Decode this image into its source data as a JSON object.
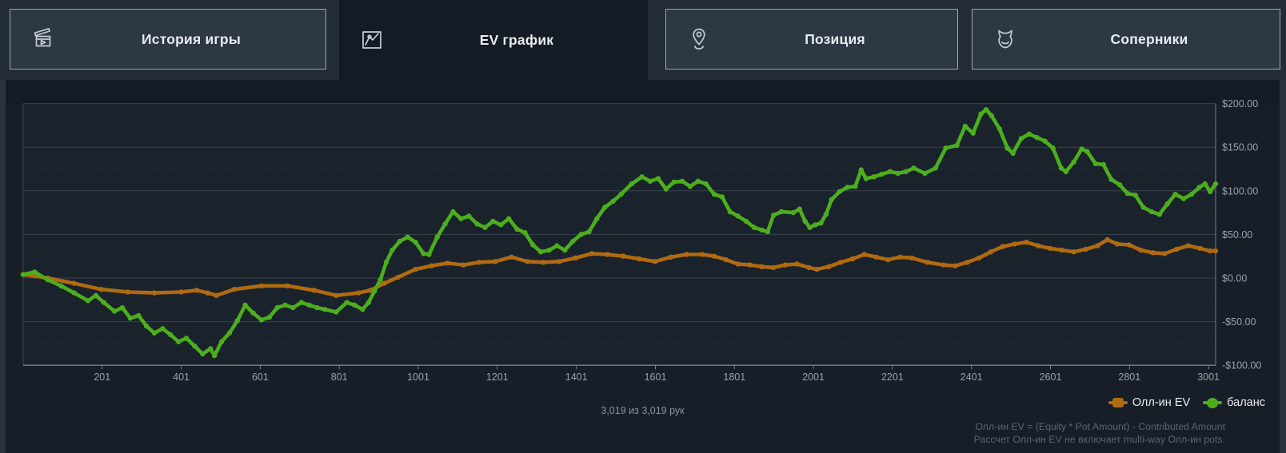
{
  "tabs": [
    {
      "label": "История игры",
      "icon": "clapperboard-icon",
      "active": false
    },
    {
      "label": "EV график",
      "icon": "line-chart-icon",
      "active": true
    },
    {
      "label": "Позиция",
      "icon": "location-pin-icon",
      "active": false
    },
    {
      "label": "Соперники",
      "icon": "opponent-mask-icon",
      "active": false
    }
  ],
  "hands_counter": "3,019 из 3,019 рук",
  "legend": [
    {
      "label": "Олл-ин EV",
      "color": "#b06a10",
      "marker": "square"
    },
    {
      "label": "баланс",
      "color": "#4cae1d",
      "marker": "circle"
    }
  ],
  "footnote": {
    "line1": "Олл-ин EV = (Equity * Pot Amount) - Contributed Amount",
    "line2": "Рассчет Олл-ин EV не включает multi-way Олл-ин pots."
  },
  "colors": {
    "allin_ev": "#b06a10",
    "balance": "#4cae1d",
    "grid_major": "#39434e",
    "grid_minor": "#2a3440",
    "axis": "#78828c",
    "tick_text": "#99a1a9",
    "panel_bg": "#171e28",
    "plot_bg": "#1a222c"
  },
  "chart_data": {
    "type": "line",
    "title": "",
    "xlabel": "",
    "ylabel": "",
    "xlim": [
      1,
      3019
    ],
    "ylim": [
      -100,
      200
    ],
    "x_ticks": [
      201,
      401,
      601,
      801,
      1001,
      1201,
      1401,
      1601,
      1801,
      2001,
      2201,
      2401,
      2601,
      2801,
      3001
    ],
    "y_ticks": [
      {
        "value": 200,
        "label": "$200.00"
      },
      {
        "value": 150,
        "label": "$150.00"
      },
      {
        "value": 100,
        "label": "$100.00"
      },
      {
        "value": 50,
        "label": "$50.00"
      },
      {
        "value": 0,
        "label": "$0.00"
      },
      {
        "value": -50,
        "label": "-$50.00"
      },
      {
        "value": -100,
        "label": "-$100.00"
      }
    ],
    "minor_grid_values": [
      175,
      125,
      75,
      25,
      -25,
      -75
    ],
    "grid": "horizontal",
    "legend_position": "bottom-right",
    "series": [
      {
        "name": "Олл-ин EV",
        "color": "#b06a10",
        "points": [
          [
            1,
            4
          ],
          [
            63,
            0
          ],
          [
            130,
            -6
          ],
          [
            199,
            -13
          ],
          [
            266,
            -16
          ],
          [
            333,
            -17
          ],
          [
            401,
            -16
          ],
          [
            440,
            -14
          ],
          [
            468,
            -17
          ],
          [
            490,
            -20
          ],
          [
            535,
            -13
          ],
          [
            604,
            -9
          ],
          [
            670,
            -9
          ],
          [
            737,
            -14
          ],
          [
            793,
            -20
          ],
          [
            850,
            -17
          ],
          [
            880,
            -14
          ],
          [
            915,
            -6
          ],
          [
            950,
            1
          ],
          [
            994,
            10
          ],
          [
            1034,
            14
          ],
          [
            1075,
            17
          ],
          [
            1115,
            15
          ],
          [
            1155,
            18
          ],
          [
            1196,
            19
          ],
          [
            1237,
            24
          ],
          [
            1277,
            19
          ],
          [
            1318,
            18
          ],
          [
            1358,
            19
          ],
          [
            1399,
            23
          ],
          [
            1440,
            28
          ],
          [
            1480,
            27
          ],
          [
            1520,
            25
          ],
          [
            1560,
            22
          ],
          [
            1600,
            19
          ],
          [
            1640,
            24
          ],
          [
            1680,
            27
          ],
          [
            1720,
            27
          ],
          [
            1750,
            25
          ],
          [
            1780,
            21
          ],
          [
            1810,
            16
          ],
          [
            1840,
            15
          ],
          [
            1870,
            13
          ],
          [
            1900,
            12
          ],
          [
            1930,
            15
          ],
          [
            1960,
            16
          ],
          [
            1990,
            12
          ],
          [
            2010,
            10
          ],
          [
            2040,
            13
          ],
          [
            2070,
            18
          ],
          [
            2100,
            22
          ],
          [
            2130,
            27
          ],
          [
            2160,
            24
          ],
          [
            2190,
            21
          ],
          [
            2220,
            24
          ],
          [
            2250,
            23
          ],
          [
            2290,
            18
          ],
          [
            2330,
            15
          ],
          [
            2360,
            14
          ],
          [
            2390,
            18
          ],
          [
            2420,
            23
          ],
          [
            2450,
            30
          ],
          [
            2480,
            36
          ],
          [
            2510,
            39
          ],
          [
            2540,
            41
          ],
          [
            2570,
            37
          ],
          [
            2600,
            34
          ],
          [
            2630,
            32
          ],
          [
            2660,
            30
          ],
          [
            2690,
            33
          ],
          [
            2720,
            37
          ],
          [
            2745,
            44
          ],
          [
            2770,
            39
          ],
          [
            2800,
            38
          ],
          [
            2830,
            32
          ],
          [
            2860,
            29
          ],
          [
            2890,
            28
          ],
          [
            2920,
            33
          ],
          [
            2950,
            37
          ],
          [
            2980,
            34
          ],
          [
            3005,
            31
          ],
          [
            3019,
            31
          ]
        ]
      },
      {
        "name": "баланс",
        "color": "#4cae1d",
        "points": [
          [
            1,
            4
          ],
          [
            30,
            7
          ],
          [
            63,
            -2
          ],
          [
            97,
            -9
          ],
          [
            130,
            -17
          ],
          [
            165,
            -26
          ],
          [
            185,
            -20
          ],
          [
            205,
            -28
          ],
          [
            232,
            -38
          ],
          [
            252,
            -34
          ],
          [
            272,
            -46
          ],
          [
            293,
            -43
          ],
          [
            313,
            -55
          ],
          [
            333,
            -63
          ],
          [
            354,
            -58
          ],
          [
            374,
            -65
          ],
          [
            394,
            -73
          ],
          [
            414,
            -69
          ],
          [
            435,
            -78
          ],
          [
            455,
            -87
          ],
          [
            475,
            -81
          ],
          [
            485,
            -89
          ],
          [
            503,
            -73
          ],
          [
            523,
            -63
          ],
          [
            543,
            -49
          ],
          [
            563,
            -31
          ],
          [
            583,
            -40
          ],
          [
            604,
            -48
          ],
          [
            624,
            -45
          ],
          [
            644,
            -34
          ],
          [
            664,
            -31
          ],
          [
            684,
            -34
          ],
          [
            705,
            -28
          ],
          [
            725,
            -31
          ],
          [
            745,
            -34
          ],
          [
            765,
            -36
          ],
          [
            793,
            -39
          ],
          [
            820,
            -28
          ],
          [
            840,
            -31
          ],
          [
            860,
            -36
          ],
          [
            875,
            -28
          ],
          [
            890,
            -15
          ],
          [
            905,
            -2
          ],
          [
            920,
            18
          ],
          [
            935,
            32
          ],
          [
            954,
            42
          ],
          [
            974,
            47
          ],
          [
            994,
            41
          ],
          [
            1014,
            28
          ],
          [
            1028,
            27
          ],
          [
            1049,
            47
          ],
          [
            1069,
            62
          ],
          [
            1089,
            76
          ],
          [
            1109,
            68
          ],
          [
            1129,
            71
          ],
          [
            1150,
            62
          ],
          [
            1170,
            58
          ],
          [
            1190,
            65
          ],
          [
            1210,
            61
          ],
          [
            1230,
            68
          ],
          [
            1251,
            56
          ],
          [
            1271,
            52
          ],
          [
            1291,
            38
          ],
          [
            1311,
            30
          ],
          [
            1332,
            32
          ],
          [
            1352,
            37
          ],
          [
            1372,
            32
          ],
          [
            1392,
            42
          ],
          [
            1413,
            50
          ],
          [
            1433,
            53
          ],
          [
            1453,
            68
          ],
          [
            1473,
            81
          ],
          [
            1494,
            88
          ],
          [
            1514,
            96
          ],
          [
            1541,
            108
          ],
          [
            1567,
            116
          ],
          [
            1588,
            111
          ],
          [
            1608,
            114
          ],
          [
            1628,
            102
          ],
          [
            1648,
            110
          ],
          [
            1669,
            111
          ],
          [
            1689,
            105
          ],
          [
            1709,
            111
          ],
          [
            1729,
            108
          ],
          [
            1750,
            96
          ],
          [
            1770,
            93
          ],
          [
            1790,
            76
          ],
          [
            1810,
            71
          ],
          [
            1831,
            65
          ],
          [
            1851,
            58
          ],
          [
            1871,
            55
          ],
          [
            1885,
            53
          ],
          [
            1900,
            72
          ],
          [
            1920,
            76
          ],
          [
            1950,
            75
          ],
          [
            1966,
            79
          ],
          [
            1980,
            65
          ],
          [
            1992,
            58
          ],
          [
            2006,
            61
          ],
          [
            2020,
            63
          ],
          [
            2033,
            73
          ],
          [
            2047,
            90
          ],
          [
            2067,
            99
          ],
          [
            2087,
            104
          ],
          [
            2107,
            105
          ],
          [
            2122,
            124
          ],
          [
            2134,
            114
          ],
          [
            2154,
            116
          ],
          [
            2174,
            119
          ],
          [
            2195,
            122
          ],
          [
            2215,
            120
          ],
          [
            2235,
            122
          ],
          [
            2255,
            126
          ],
          [
            2283,
            120
          ],
          [
            2310,
            126
          ],
          [
            2336,
            149
          ],
          [
            2364,
            152
          ],
          [
            2385,
            174
          ],
          [
            2405,
            166
          ],
          [
            2425,
            188
          ],
          [
            2438,
            193
          ],
          [
            2452,
            186
          ],
          [
            2472,
            171
          ],
          [
            2492,
            149
          ],
          [
            2506,
            143
          ],
          [
            2527,
            160
          ],
          [
            2547,
            165
          ],
          [
            2567,
            161
          ],
          [
            2587,
            157
          ],
          [
            2607,
            149
          ],
          [
            2628,
            126
          ],
          [
            2640,
            122
          ],
          [
            2660,
            133
          ],
          [
            2680,
            148
          ],
          [
            2694,
            145
          ],
          [
            2715,
            131
          ],
          [
            2735,
            130
          ],
          [
            2755,
            113
          ],
          [
            2776,
            107
          ],
          [
            2796,
            97
          ],
          [
            2816,
            95
          ],
          [
            2836,
            81
          ],
          [
            2857,
            76
          ],
          [
            2877,
            73
          ],
          [
            2897,
            85
          ],
          [
            2917,
            96
          ],
          [
            2938,
            91
          ],
          [
            2958,
            96
          ],
          [
            2978,
            104
          ],
          [
            2992,
            108
          ],
          [
            3005,
            99
          ],
          [
            3019,
            108
          ]
        ]
      }
    ]
  }
}
